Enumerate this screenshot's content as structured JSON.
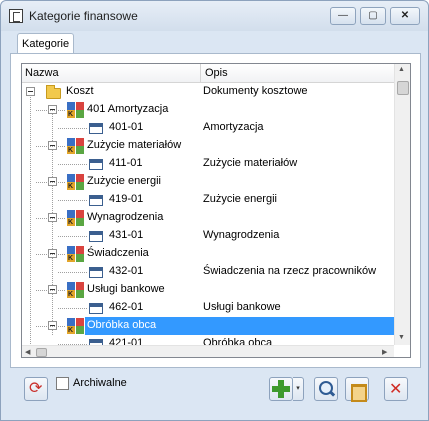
{
  "window": {
    "title": "Kategorie finansowe",
    "controls": {
      "minimize": "—",
      "maximize": "▢",
      "close": "✕"
    }
  },
  "tabs": [
    {
      "label": "Kategorie"
    }
  ],
  "grid": {
    "columns": {
      "nazwa": "Nazwa",
      "opis": "Opis"
    },
    "rows": [
      {
        "name": "Koszt",
        "desc": "Dokumenty kosztowe",
        "icon": "folder-icon"
      },
      {
        "name": "401 Amortyzacja",
        "desc": "",
        "icon": "category-icon"
      },
      {
        "name": "401-01",
        "desc": "Amortyzacja",
        "icon": "document-icon"
      },
      {
        "name": "Zużycie materiałów",
        "desc": "",
        "icon": "category-icon"
      },
      {
        "name": "411-01",
        "desc": "Zużycie materiałów",
        "icon": "document-icon"
      },
      {
        "name": "Zużycie energii",
        "desc": "",
        "icon": "category-icon"
      },
      {
        "name": "419-01",
        "desc": "Zużycie energii",
        "icon": "document-icon"
      },
      {
        "name": "Wynagrodzenia",
        "desc": "",
        "icon": "category-icon"
      },
      {
        "name": "431-01",
        "desc": "Wynagrodzenia",
        "icon": "document-icon"
      },
      {
        "name": "Świadczenia",
        "desc": "",
        "icon": "category-icon"
      },
      {
        "name": "432-01",
        "desc": "Świadczenia na rzecz pracowników",
        "icon": "document-icon"
      },
      {
        "name": "Usługi bankowe",
        "desc": "",
        "icon": "category-icon"
      },
      {
        "name": "462-01",
        "desc": "Usługi bankowe",
        "icon": "document-icon"
      },
      {
        "name": "Obróbka obca",
        "desc": "",
        "icon": "category-icon",
        "selected": true
      },
      {
        "name": "421-01",
        "desc": "Obróbka obca",
        "icon": "document-icon"
      }
    ]
  },
  "footer": {
    "archiwalne_label": "Archiwalne",
    "archiwalne_checked": false,
    "add_dropdown_glyph": "▾"
  },
  "colors": {
    "selection": "#3399ff",
    "window_bg": "#dbe6f3"
  }
}
